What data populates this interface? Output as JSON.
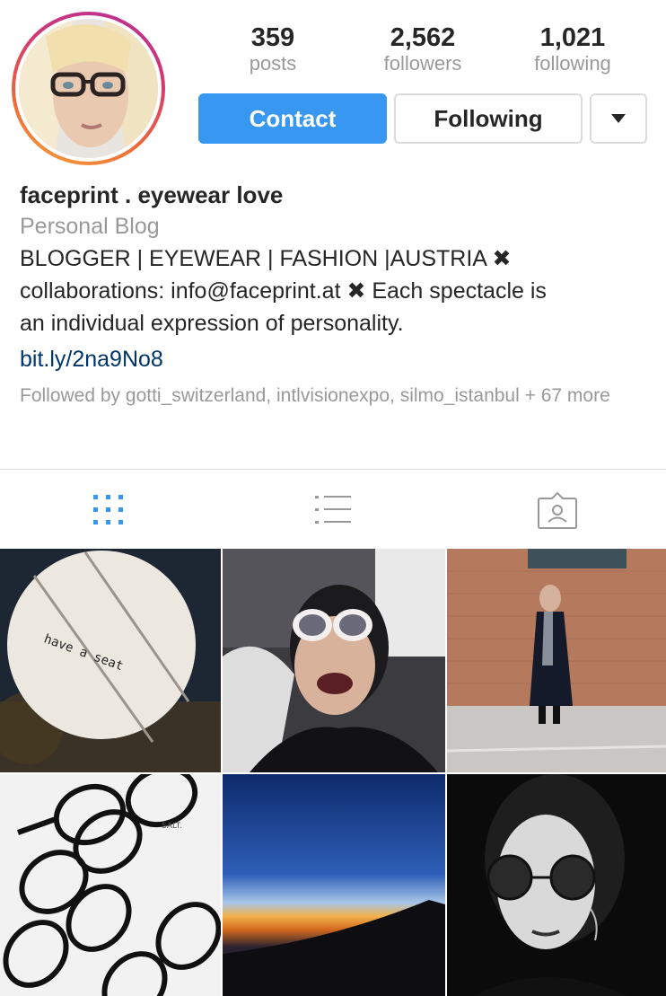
{
  "profile": {
    "stats": [
      {
        "value": "359",
        "label": "posts"
      },
      {
        "value": "2,562",
        "label": "followers"
      },
      {
        "value": "1,021",
        "label": "following"
      }
    ],
    "buttons": {
      "contact": "Contact",
      "following": "Following"
    },
    "name": "faceprint . eyewear love",
    "category": "Personal Blog",
    "bio_lines": [
      "BLOGGER | EYEWEAR | FASHION |AUSTRIA ✖",
      "collaborations: info@faceprint.at  ✖  Each spectacle is",
      "an individual expression of personality."
    ],
    "link": "bit.ly/2na9No8",
    "followed_by": "Followed by gotti_switzerland, intlvisionexpo, silmo_istanbul + 67 more"
  },
  "tabs": [
    {
      "icon": "grid-icon",
      "active": true
    },
    {
      "icon": "list-icon",
      "active": false
    },
    {
      "icon": "tagged-icon",
      "active": false
    }
  ],
  "colors": {
    "accent": "#3897f0",
    "link": "#003569",
    "muted": "#999999",
    "text": "#262626",
    "border": "#dbdbdb"
  },
  "posts": [
    {
      "description": "have a seat wooden board",
      "text": "have a seat"
    },
    {
      "description": "smiling woman with white sunglasses"
    },
    {
      "description": "woman in black coat by brick wall"
    },
    {
      "description": "black eyeglasses on white",
      "text": "SALT."
    },
    {
      "description": "sunset above clouds from airplane window"
    },
    {
      "description": "black and white portrait with round sunglasses"
    }
  ]
}
